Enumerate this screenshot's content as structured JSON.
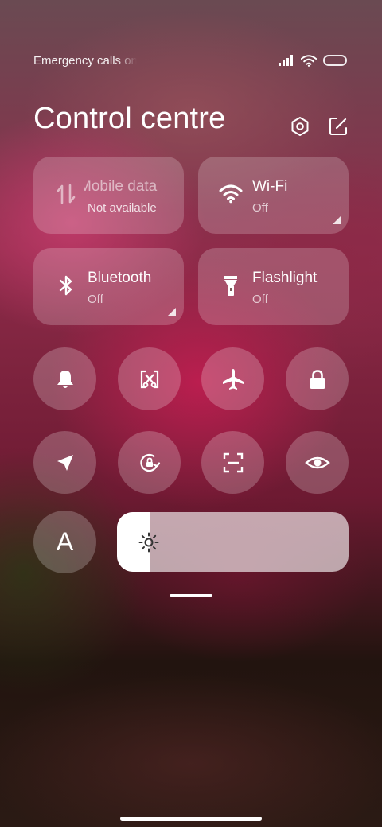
{
  "status_bar": {
    "carrier_text": "Emergency calls only",
    "icons": [
      "signal-icon",
      "wifi-icon",
      "battery-icon"
    ]
  },
  "header": {
    "title": "Control centre",
    "icons": [
      "settings-icon",
      "edit-icon"
    ]
  },
  "tiles": [
    {
      "name": "mobile-data",
      "label": "Mobile data",
      "status": "Not available",
      "icon": "mobile-data-icon",
      "state": "disabled"
    },
    {
      "name": "wifi",
      "label": "Wi-Fi",
      "status": "Off",
      "icon": "wifi-icon",
      "state": "off"
    },
    {
      "name": "bluetooth",
      "label": "Bluetooth",
      "status": "Off",
      "icon": "bluetooth-icon",
      "state": "off"
    },
    {
      "name": "flashlight",
      "label": "Flashlight",
      "status": "Off",
      "icon": "flashlight-icon",
      "state": "off"
    }
  ],
  "toggles": [
    {
      "name": "silent",
      "icon": "bell-icon"
    },
    {
      "name": "screenshot",
      "icon": "screenshot-icon"
    },
    {
      "name": "airplane-mode",
      "icon": "airplane-icon"
    },
    {
      "name": "lock-screen",
      "icon": "lock-icon"
    },
    {
      "name": "location",
      "icon": "location-arrow-icon"
    },
    {
      "name": "rotation-lock",
      "icon": "rotation-lock-icon"
    },
    {
      "name": "scanner",
      "icon": "scan-icon"
    },
    {
      "name": "reading-mode",
      "icon": "eye-icon"
    }
  ],
  "font_toggle": {
    "label": "A",
    "icon": "font-size-icon"
  },
  "brightness": {
    "icon": "sun-icon",
    "level_fraction": 0.14
  },
  "colors": {
    "tile_bg": "rgba(255,255,255,0.2)",
    "toggle_bg": "rgba(255,255,255,0.22)",
    "brightness_track": "rgba(255,255,255,0.62)",
    "brightness_fill": "#ffffff"
  }
}
